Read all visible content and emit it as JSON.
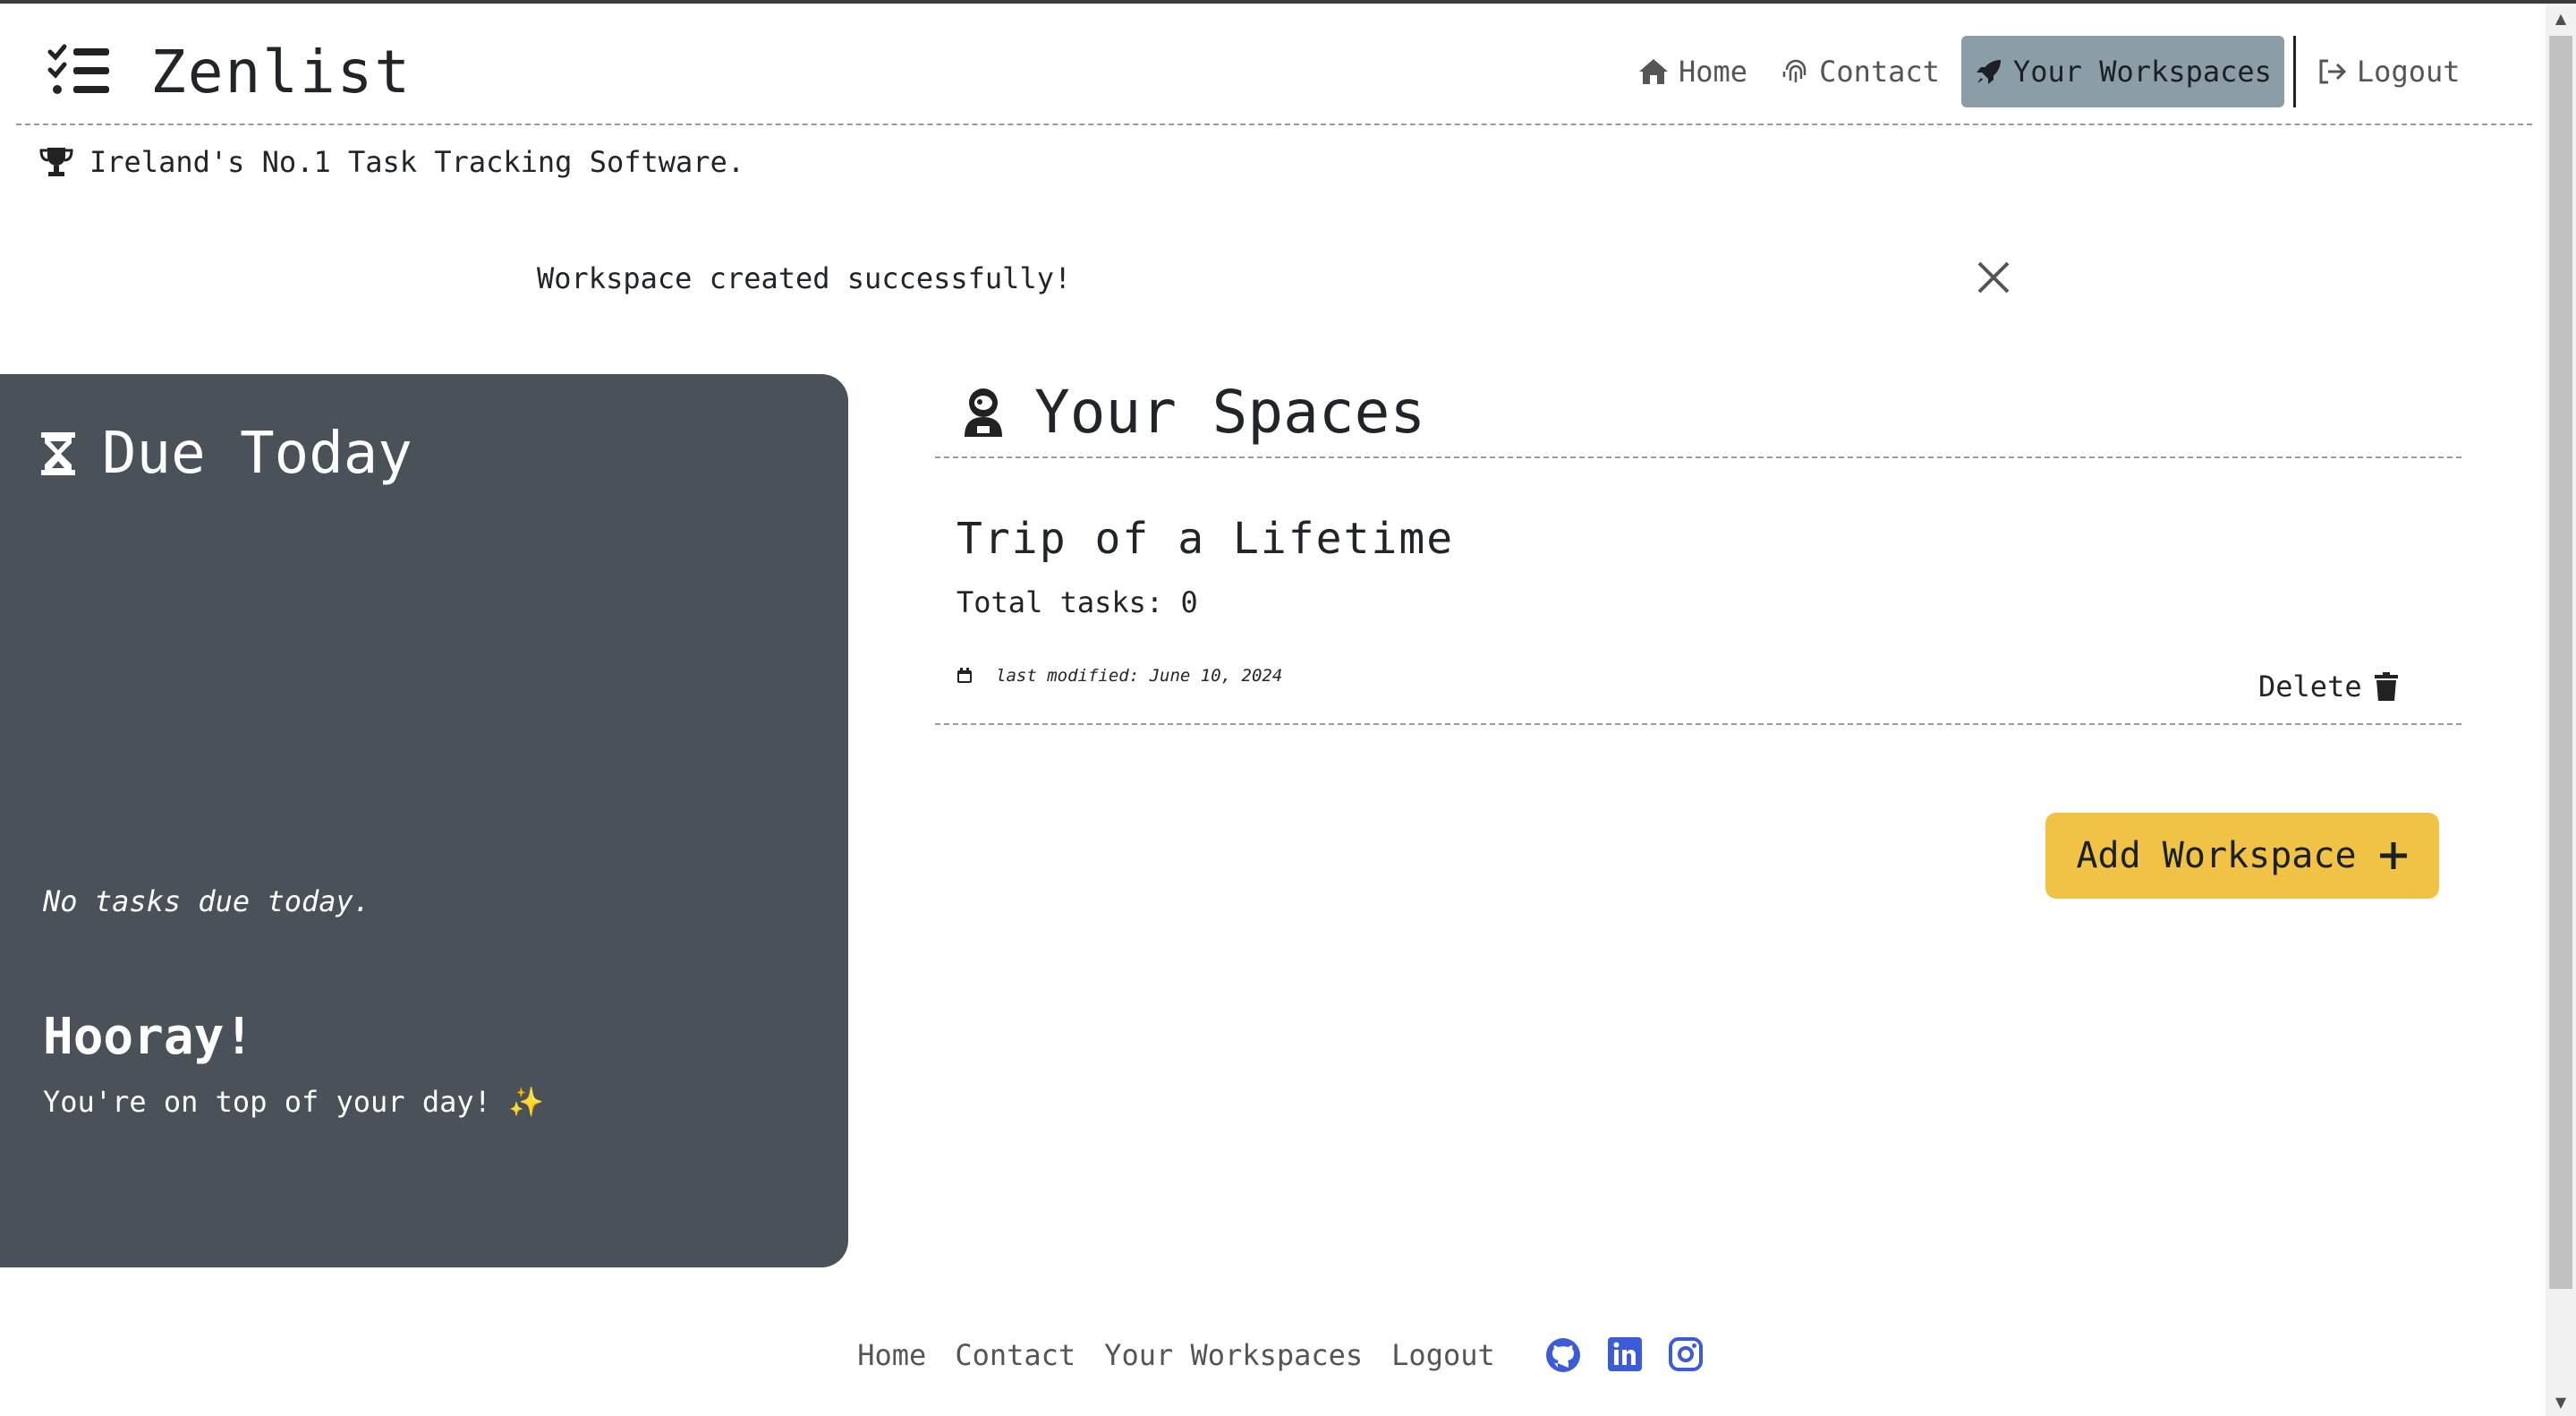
{
  "brand": {
    "name": "Zenlist",
    "logo_icon": "checklist-icon"
  },
  "nav": {
    "items": [
      {
        "label": "Home",
        "icon": "home-icon"
      },
      {
        "label": "Contact",
        "icon": "fingerprint-icon"
      },
      {
        "label": "Your Workspaces",
        "icon": "rocket-icon",
        "active": true
      },
      {
        "label": "Logout",
        "icon": "logout-icon"
      }
    ]
  },
  "tagline": {
    "text": "Ireland's No.1 Task Tracking Software.",
    "icon": "trophy-icon"
  },
  "alert": {
    "message": "Workspace created successfully!",
    "close_icon": "close-icon"
  },
  "due_today": {
    "title": "Due Today",
    "icon": "hourglass-icon",
    "empty_message": "No tasks due today.",
    "hooray_title": "Hooray!",
    "hooray_message": "You're on top of your day! ✨"
  },
  "spaces": {
    "title": "Your Spaces",
    "icon": "astronaut-icon",
    "workspaces": [
      {
        "name": "Trip of a Lifetime",
        "total_tasks": "Total tasks: 0",
        "last_modified": "last modified: June 10, 2024",
        "delete_label": "Delete"
      }
    ],
    "add_button_label": "Add Workspace"
  },
  "footer": {
    "links": [
      "Home",
      "Contact",
      "Your Workspaces",
      "Logout"
    ],
    "social": [
      "github-icon",
      "linkedin-icon",
      "instagram-icon"
    ]
  },
  "colors": {
    "panel_bg": "#4b5158",
    "active_nav_bg": "#8b9ea8",
    "add_button_bg": "#f0c347",
    "social_blue": "#3b5bdb"
  }
}
